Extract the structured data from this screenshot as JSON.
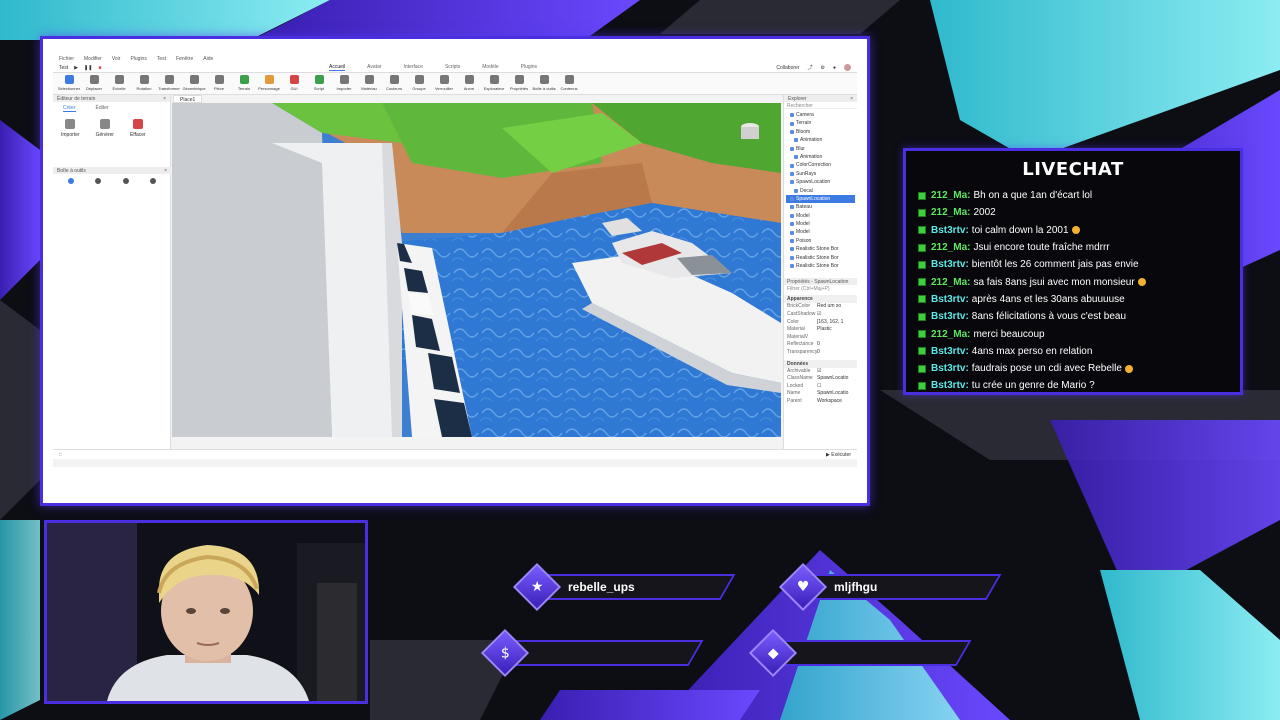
{
  "colors": {
    "accent_purple": "#4a2fe0",
    "accent_cyan": "#4fd6e0",
    "chat_green": "#3ecf3e"
  },
  "studio": {
    "menu": [
      "Fichier",
      "Modifier",
      "Voir",
      "Plugins",
      "Test",
      "Fenêtre",
      "Aide"
    ],
    "place_selector": "Test",
    "tabs": [
      "Accueil",
      "Avatar",
      "Interface",
      "Scripts",
      "Modèle",
      "Plugins"
    ],
    "collaborate_label": "Collaborer",
    "ribbon_tools": [
      {
        "label": "Sélectionner",
        "icon": "cursor-icon"
      },
      {
        "label": "Déplacer",
        "icon": "move-icon"
      },
      {
        "label": "Échelle",
        "icon": "scale-icon"
      },
      {
        "label": "Rotation",
        "icon": "rotate-icon"
      },
      {
        "label": "Transformer",
        "icon": "transform-icon"
      },
      {
        "label": "Géométrique",
        "icon": "geometry-icon"
      },
      {
        "label": "Pièce",
        "icon": "part-icon"
      },
      {
        "label": "Terrain",
        "icon": "terrain-icon"
      },
      {
        "label": "Personnage",
        "icon": "character-icon"
      },
      {
        "label": "GUI",
        "icon": "gui-icon"
      },
      {
        "label": "Script",
        "icon": "script-icon"
      },
      {
        "label": "Importer",
        "icon": "import-icon"
      },
      {
        "label": "Matériau",
        "icon": "material-icon"
      },
      {
        "label": "Couleurs",
        "icon": "color-icon"
      },
      {
        "label": "Groupe",
        "icon": "group-icon"
      },
      {
        "label": "Verrouiller",
        "icon": "lock-icon"
      },
      {
        "label": "Ancré",
        "icon": "anchor-icon"
      },
      {
        "label": "Explorateur",
        "icon": "explorer-icon"
      },
      {
        "label": "Propriétés",
        "icon": "properties-icon"
      },
      {
        "label": "Boîte à outils",
        "icon": "toolbox-icon"
      },
      {
        "label": "Contenus",
        "icon": "content-icon"
      }
    ],
    "terrain_editor": {
      "title": "Éditeur de terrain",
      "tabs": [
        "Créer",
        "Éditer"
      ],
      "tools": [
        "Importer",
        "Générer",
        "Effacer"
      ]
    },
    "toolbox_title": "Boîte à outils",
    "doc_tab": "Place1",
    "explorer": {
      "title": "Explorer",
      "search_placeholder": "Rechercher",
      "items": [
        {
          "label": "Camera",
          "indent": 1
        },
        {
          "label": "Terrain",
          "indent": 1
        },
        {
          "label": "Bloom",
          "indent": 1
        },
        {
          "label": "Animation",
          "indent": 2
        },
        {
          "label": "Blur",
          "indent": 1
        },
        {
          "label": "Animation",
          "indent": 2
        },
        {
          "label": "ColorCorrection",
          "indent": 1
        },
        {
          "label": "SunRays",
          "indent": 1
        },
        {
          "label": "SpawnLocation",
          "indent": 1
        },
        {
          "label": "Decal",
          "indent": 2
        },
        {
          "label": "SpawnLocation",
          "indent": 1,
          "selected": true
        },
        {
          "label": "Bateau",
          "indent": 1
        },
        {
          "label": "Model",
          "indent": 1
        },
        {
          "label": "Model",
          "indent": 1
        },
        {
          "label": "Model",
          "indent": 1
        },
        {
          "label": "Poison",
          "indent": 1
        },
        {
          "label": "Realistic Stone Bor",
          "indent": 1
        },
        {
          "label": "Realistic Stone Bor",
          "indent": 1
        },
        {
          "label": "Realistic Stone Bor",
          "indent": 1
        }
      ]
    },
    "properties": {
      "title": "Propriétés - SpawnLocation",
      "filter_placeholder": "Filtrer (Ctrl+Maj+P)",
      "sections": [
        {
          "name": "Apparence",
          "rows": [
            {
              "k": "BrickColor",
              "v": "Red um so"
            },
            {
              "k": "CastShadow",
              "v": "☑"
            },
            {
              "k": "Color",
              "v": "[163, 162, 1"
            },
            {
              "k": "Material",
              "v": "Plastic"
            },
            {
              "k": "MaterialV",
              "v": ""
            },
            {
              "k": "Reflectance",
              "v": "0"
            },
            {
              "k": "Transparency",
              "v": "0"
            }
          ]
        },
        {
          "name": "Données",
          "rows": [
            {
              "k": "Archivable",
              "v": "☑"
            },
            {
              "k": "ClassName",
              "v": "SpawnLocatio"
            },
            {
              "k": "Locked",
              "v": "☐"
            },
            {
              "k": "Name",
              "v": "SpawnLocatio"
            },
            {
              "k": "Parent",
              "v": "Workspace"
            }
          ]
        }
      ]
    },
    "status_left": "::",
    "run_label": "Exécuter"
  },
  "livechat": {
    "title": "LIVECHAT",
    "messages": [
      {
        "user": "212_Ma:",
        "text": "Bh on a que 1an d'écart lol",
        "color": "c1"
      },
      {
        "user": "212_Ma:",
        "text": "2002",
        "color": "c1"
      },
      {
        "user": "Bst3rtv:",
        "text": "toi calm down la 2001",
        "color": "c2",
        "emoji": true
      },
      {
        "user": "212_Ma:",
        "text": "Jsui encore toute fraîche mdrrr",
        "color": "c1"
      },
      {
        "user": "Bst3rtv:",
        "text": "bientôt les 26 comment jais pas envie",
        "color": "c2"
      },
      {
        "user": "212_Ma:",
        "text": "sa fais 8ans jsui avec mon monsieur",
        "color": "c1",
        "emoji": true
      },
      {
        "user": "Bst3rtv:",
        "text": "après 4ans et les 30ans abuuuuse",
        "color": "c2"
      },
      {
        "user": "Bst3rtv:",
        "text": "8ans félicitations à vous c'est beau",
        "color": "c2"
      },
      {
        "user": "212_Ma:",
        "text": "merci beaucoup",
        "color": "c1"
      },
      {
        "user": "Bst3rtv:",
        "text": "4ans max perso en relation",
        "color": "c2"
      },
      {
        "user": "Bst3rtv:",
        "text": "faudrais pose un cdi avec Rebelle",
        "color": "c2",
        "emoji": true
      },
      {
        "user": "Bst3rtv:",
        "text": "tu crée un genre de Mario ?",
        "color": "c2"
      }
    ]
  },
  "socials": [
    {
      "icon": "star-icon",
      "glyph": "★",
      "label": "rebelle_ups"
    },
    {
      "icon": "heart-icon",
      "glyph": "♥",
      "label": "mljfhgu"
    },
    {
      "icon": "dollar-icon",
      "glyph": "$",
      "label": ""
    },
    {
      "icon": "diamond-icon",
      "glyph": "◆",
      "label": ""
    }
  ]
}
